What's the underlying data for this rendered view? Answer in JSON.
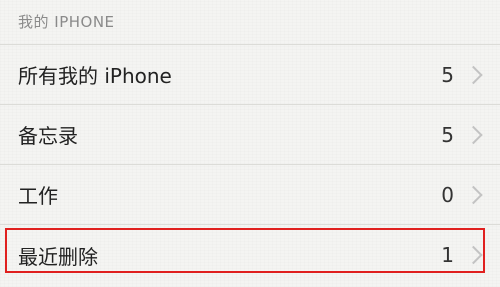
{
  "section": {
    "header": "我的 IPHONE"
  },
  "folders": [
    {
      "label": "所有我的 iPhone",
      "count": "5"
    },
    {
      "label": "备忘录",
      "count": "5"
    },
    {
      "label": "工作",
      "count": "0"
    },
    {
      "label": "最近删除",
      "count": "1"
    }
  ],
  "icons": {
    "chevron": "chevron-right-icon"
  },
  "colors": {
    "background": "#f4f4f2",
    "highlight": "#e0201f",
    "header_text": "#8a8a8a",
    "chevron": "#c3c3c3"
  }
}
